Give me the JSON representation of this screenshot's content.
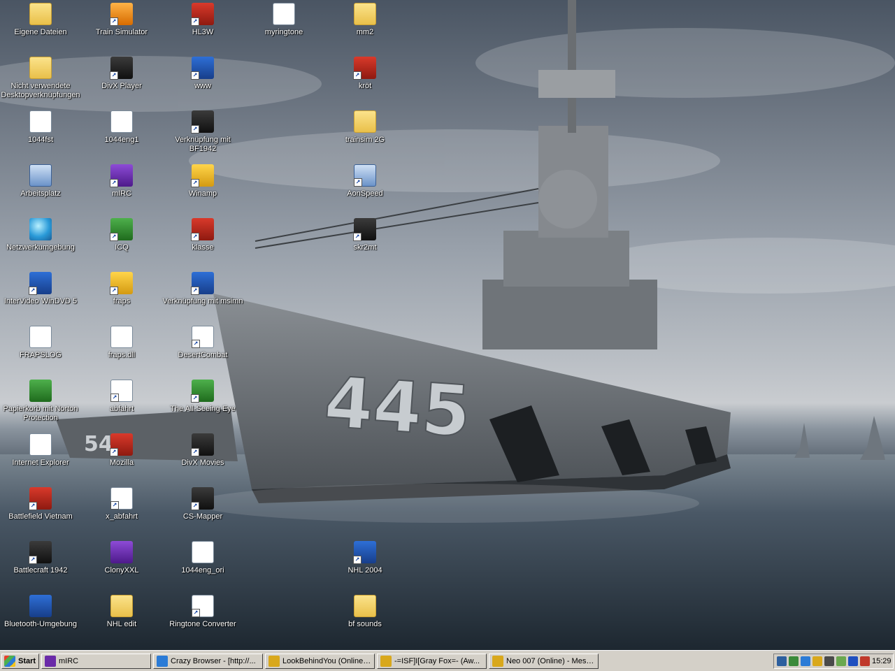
{
  "desktop": {
    "icons": [
      {
        "label": "Eigene Dateien",
        "col": 0,
        "row": 0,
        "glyph": "folder-doc-icon",
        "style": "g-folder",
        "text": "",
        "shortcut": false
      },
      {
        "label": "Nicht verwendete Desktopverknüpfungen",
        "col": 0,
        "row": 1,
        "glyph": "folder-icon",
        "style": "g-folder",
        "text": "",
        "shortcut": false
      },
      {
        "label": "1044fst",
        "col": 0,
        "row": 2,
        "glyph": "document-icon",
        "style": "g-doc",
        "text": "",
        "shortcut": false
      },
      {
        "label": "Arbeitsplatz",
        "col": 0,
        "row": 3,
        "glyph": "my-computer-icon",
        "style": "g-computer",
        "text": "",
        "shortcut": false
      },
      {
        "label": "Netzwerkumgebung",
        "col": 0,
        "row": 4,
        "glyph": "network-globe-icon",
        "style": "g-globe",
        "text": "",
        "shortcut": false
      },
      {
        "label": "InterVideo WinDVD 5",
        "col": 0,
        "row": 5,
        "glyph": "windvd-icon",
        "style": "g-blue",
        "text": "",
        "shortcut": true
      },
      {
        "label": "FRAPSLOG",
        "col": 0,
        "row": 6,
        "glyph": "text-file-icon",
        "style": "g-doc",
        "text": "",
        "shortcut": false
      },
      {
        "label": "Papierkorb mit Norton Protection",
        "col": 0,
        "row": 7,
        "glyph": "recycle-bin-icon",
        "style": "g-green",
        "text": "",
        "shortcut": false
      },
      {
        "label": "Internet Explorer",
        "col": 0,
        "row": 8,
        "glyph": "internet-explorer-icon",
        "style": "g-doc",
        "text": "",
        "shortcut": false
      },
      {
        "label": "Battlefield Vietnam",
        "col": 0,
        "row": 9,
        "glyph": "battlefield-vietnam-icon",
        "style": "g-red",
        "text": "",
        "shortcut": true
      },
      {
        "label": "Battlecraft 1942",
        "col": 0,
        "row": 10,
        "glyph": "battlecraft-icon",
        "style": "g-dark",
        "text": "",
        "shortcut": true
      },
      {
        "label": "Bluetooth-Umgebung",
        "col": 0,
        "row": 11,
        "glyph": "bluetooth-icon",
        "style": "g-blue",
        "text": "",
        "shortcut": false
      },
      {
        "label": "Train Simulator",
        "col": 1,
        "row": 0,
        "glyph": "train-simulator-icon",
        "style": "g-orange",
        "text": "",
        "shortcut": true
      },
      {
        "label": "DivX Player",
        "col": 1,
        "row": 1,
        "glyph": "divx-player-icon",
        "style": "g-dark",
        "text": "",
        "shortcut": true
      },
      {
        "label": "1044eng1",
        "col": 1,
        "row": 2,
        "glyph": "document-icon",
        "style": "g-doc",
        "text": "",
        "shortcut": false
      },
      {
        "label": "mIRC",
        "col": 1,
        "row": 3,
        "glyph": "mirc-icon",
        "style": "g-purple",
        "text": "",
        "shortcut": true
      },
      {
        "label": "ICQ",
        "col": 1,
        "row": 4,
        "glyph": "icq-flower-icon",
        "style": "g-green",
        "text": "",
        "shortcut": true
      },
      {
        "label": "fraps",
        "col": 1,
        "row": 5,
        "glyph": "fraps-icon",
        "style": "g-yellow",
        "text": "",
        "shortcut": true
      },
      {
        "label": "fraps.dll",
        "col": 1,
        "row": 6,
        "glyph": "dll-file-icon",
        "style": "g-doc",
        "text": "",
        "shortcut": false
      },
      {
        "label": "abfahrt",
        "col": 1,
        "row": 7,
        "glyph": "media-file-icon",
        "style": "g-doc",
        "text": "",
        "shortcut": true
      },
      {
        "label": "Mozilla",
        "col": 1,
        "row": 8,
        "glyph": "mozilla-icon",
        "style": "g-red",
        "text": "",
        "shortcut": true
      },
      {
        "label": "x_abfahrt",
        "col": 1,
        "row": 9,
        "glyph": "media-file-icon",
        "style": "g-doc",
        "text": "",
        "shortcut": true
      },
      {
        "label": "ClonyXXL",
        "col": 1,
        "row": 10,
        "glyph": "clonyxxl-icon",
        "style": "g-purple",
        "text": "",
        "shortcut": false
      },
      {
        "label": "NHL edit",
        "col": 1,
        "row": 11,
        "glyph": "folder-icon",
        "style": "g-folder",
        "text": "",
        "shortcut": false
      },
      {
        "label": "HL3W",
        "col": 2,
        "row": 0,
        "glyph": "hl3w-icon",
        "style": "g-red",
        "text": "",
        "shortcut": true
      },
      {
        "label": "www",
        "col": 2,
        "row": 1,
        "glyph": "www-star-icon",
        "style": "g-blue",
        "text": "",
        "shortcut": true
      },
      {
        "label": "Verknüpfung mit BF1942",
        "col": 2,
        "row": 2,
        "glyph": "battlefield-1942-icon",
        "style": "g-dark",
        "text": "",
        "shortcut": true
      },
      {
        "label": "Winamp",
        "col": 2,
        "row": 3,
        "glyph": "winamp-icon",
        "style": "g-yellow",
        "text": "",
        "shortcut": true
      },
      {
        "label": "klasse",
        "col": 2,
        "row": 4,
        "glyph": "dragon-icon",
        "style": "g-red",
        "text": "",
        "shortcut": true
      },
      {
        "label": "Verknüpfung mit msimn",
        "col": 2,
        "row": 5,
        "glyph": "outlook-express-icon",
        "style": "g-blue",
        "text": "",
        "shortcut": true
      },
      {
        "label": "DesertCombat",
        "col": 2,
        "row": 6,
        "glyph": "desert-combat-icon",
        "style": "g-doc",
        "text": "",
        "shortcut": true
      },
      {
        "label": "The All-Seeing Eye",
        "col": 2,
        "row": 7,
        "glyph": "all-seeing-eye-icon",
        "style": "g-green",
        "text": "",
        "shortcut": true
      },
      {
        "label": "DivX Movies",
        "col": 2,
        "row": 8,
        "glyph": "divx-movies-icon",
        "style": "g-dark",
        "text": "",
        "shortcut": true
      },
      {
        "label": "CS-Mapper",
        "col": 2,
        "row": 9,
        "glyph": "cs-mapper-icon",
        "style": "g-dark",
        "text": "",
        "shortcut": true
      },
      {
        "label": "1044eng_ori",
        "col": 2,
        "row": 10,
        "glyph": "document-icon",
        "style": "g-doc",
        "text": "",
        "shortcut": false
      },
      {
        "label": "Ringtone Converter",
        "col": 2,
        "row": 11,
        "glyph": "ringtone-converter-icon",
        "style": "g-doc",
        "text": "",
        "shortcut": true
      },
      {
        "label": "myringtone",
        "col": 3,
        "row": 0,
        "glyph": "media-file-icon",
        "style": "g-doc",
        "text": "",
        "shortcut": false
      },
      {
        "label": "mm2",
        "col": 4,
        "row": 0,
        "glyph": "folder-icon",
        "style": "g-folder",
        "text": "",
        "shortcut": false
      },
      {
        "label": "kröt",
        "col": 4,
        "row": 1,
        "glyph": "dragon-icon",
        "style": "g-red",
        "text": "",
        "shortcut": true
      },
      {
        "label": "trainsim 2G",
        "col": 4,
        "row": 2,
        "glyph": "folder-icon",
        "style": "g-folder",
        "text": "",
        "shortcut": false
      },
      {
        "label": "AonSpeed",
        "col": 4,
        "row": 3,
        "glyph": "aonspeed-icon",
        "style": "g-computer",
        "text": "",
        "shortcut": true
      },
      {
        "label": "skr2mt",
        "col": 4,
        "row": 4,
        "glyph": "skr2mt-icon",
        "style": "g-dark",
        "text": "",
        "shortcut": true
      },
      {
        "label": "NHL 2004",
        "col": 4,
        "row": 10,
        "glyph": "nhl-2004-icon",
        "style": "g-blue",
        "text": "",
        "shortcut": true
      },
      {
        "label": "bf sounds",
        "col": 4,
        "row": 11,
        "glyph": "folder-icon",
        "style": "g-folder",
        "text": "",
        "shortcut": false
      }
    ]
  },
  "wallpaper": {
    "hull_number": "445",
    "second_hull_number": "54"
  },
  "taskbar": {
    "start_label": "Start",
    "tasks": [
      {
        "label": "mIRC",
        "icon": "mirc-icon",
        "color": "#6a2aa8"
      },
      {
        "label": "Crazy Browser - [http://...",
        "icon": "crazy-browser-icon",
        "color": "#2b7bd6"
      },
      {
        "label": "LookBehindYou (Online) -...",
        "icon": "messenger-icon",
        "color": "#d9a81c"
      },
      {
        "label": "-=ISF]I[Gray Fox=- (Aw...",
        "icon": "messenger-icon",
        "color": "#d9a81c"
      },
      {
        "label": "Neo 007 (Online) - Mess...",
        "icon": "messenger-icon",
        "color": "#d9a81c"
      }
    ],
    "tray": {
      "icons": [
        {
          "name": "tray-network-icon",
          "color": "#2d5f9e"
        },
        {
          "name": "tray-lan-icon",
          "color": "#3a8a3a"
        },
        {
          "name": "tray-browser-icon",
          "color": "#2b7bd6"
        },
        {
          "name": "tray-messenger-icon",
          "color": "#d9a81c"
        },
        {
          "name": "tray-volume-icon",
          "color": "#4a4a4a"
        },
        {
          "name": "tray-norton-icon",
          "color": "#6aa84f"
        },
        {
          "name": "tray-bluetooth-icon",
          "color": "#1f4fbf"
        },
        {
          "name": "tray-antivirus-icon",
          "color": "#c0392b"
        }
      ],
      "clock": "15:29"
    }
  }
}
